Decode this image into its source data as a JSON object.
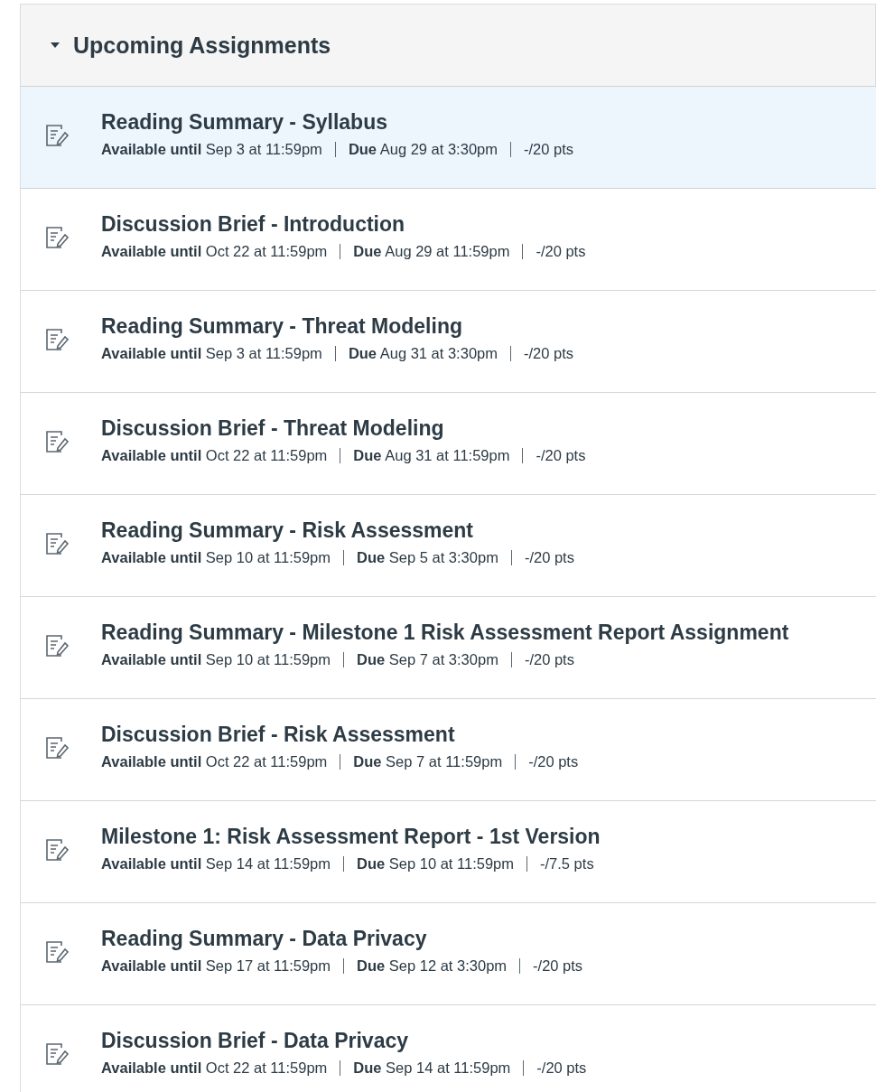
{
  "section": {
    "title": "Upcoming Assignments",
    "expanded": true
  },
  "assignments": [
    {
      "title": "Reading Summary - Syllabus",
      "availability": "**Available until** Sep 3 at 11:59pm",
      "due": "**Due** Aug 29 at 3:30pm",
      "points": "-/20 pts",
      "selected": true
    },
    {
      "title": "Discussion Brief - Introduction",
      "availability": "**Available until** Oct 22 at 11:59pm",
      "due": "**Due** Aug 29 at 11:59pm",
      "points": "-/20 pts",
      "selected": false
    },
    {
      "title": "Reading Summary - Threat Modeling",
      "availability": "**Available until** Sep 3 at 11:59pm",
      "due": "**Due** Aug 31 at 3:30pm",
      "points": "-/20 pts",
      "selected": false
    },
    {
      "title": "Discussion Brief - Threat Modeling",
      "availability": "**Available until** Oct 22 at 11:59pm",
      "due": "**Due** Aug 31 at 11:59pm",
      "points": "-/20 pts",
      "selected": false
    },
    {
      "title": "Reading Summary - Risk Assessment",
      "availability": "**Available until** Sep 10 at 11:59pm",
      "due": "**Due** Sep 5 at 3:30pm",
      "points": "-/20 pts",
      "selected": false
    },
    {
      "title": "Reading Summary - Milestone 1 Risk Assessment Report Assignment",
      "availability": "**Available until** Sep 10 at 11:59pm",
      "due": "**Due** Sep 7 at 3:30pm",
      "points": "-/20 pts",
      "selected": false
    },
    {
      "title": "Discussion Brief - Risk Assessment",
      "availability": "**Available until** Oct 22 at 11:59pm",
      "due": "**Due** Sep 7 at 11:59pm",
      "points": "-/20 pts",
      "selected": false
    },
    {
      "title": "Milestone 1: Risk Assessment Report - 1st Version",
      "availability": "**Available until** Sep 14 at 11:59pm",
      "due": "**Due** Sep 10 at 11:59pm",
      "points": "-/7.5 pts",
      "selected": false
    },
    {
      "title": "Reading Summary - Data Privacy",
      "availability": "**Available until** Sep 17 at 11:59pm",
      "due": "**Due** Sep 12 at 3:30pm",
      "points": "-/20 pts",
      "selected": false
    },
    {
      "title": "Discussion Brief - Data Privacy",
      "availability": "**Available until** Oct 22 at 11:59pm",
      "due": "**Due** Sep 14 at 11:59pm",
      "points": "-/20 pts",
      "selected": false
    }
  ]
}
